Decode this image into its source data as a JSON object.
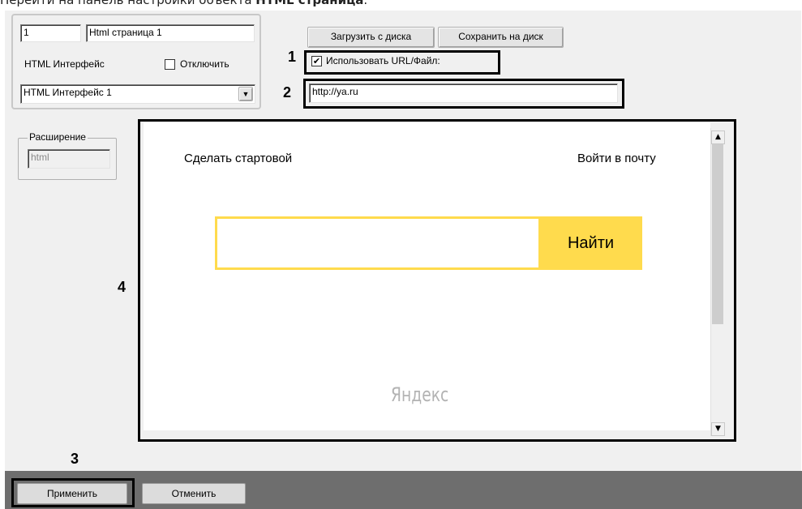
{
  "caption": {
    "text_prefix": "Перейти на панель настройки объекта ",
    "text_bold": "HTML страница",
    "text_suffix": "."
  },
  "object": {
    "id": "1",
    "name": "Html страница 1"
  },
  "interface": {
    "label": "HTML Интерфейс",
    "disable_label": "Отключить",
    "disable_checked": false,
    "selected": "HTML Интерфейс 1"
  },
  "toolbar": {
    "load_label": "Загрузить с диска",
    "save_label": "Сохранить на диск"
  },
  "use_url": {
    "label": "Использовать URL/Файл:",
    "checked": true,
    "check_glyph": "✔"
  },
  "url": {
    "value": "http://ya.ru"
  },
  "extension": {
    "group_label": "Расширение",
    "value": "html"
  },
  "browser": {
    "make_start": "Сделать стартовой",
    "login_mail": "Войти в почту",
    "search_value": "",
    "search_button": "Найти",
    "logo": "Яндекс"
  },
  "scrollbar": {
    "up_glyph": "▲",
    "down_glyph": "▼"
  },
  "dropdown": {
    "arrow_glyph": "▼"
  },
  "footer": {
    "apply_label": "Применить",
    "cancel_label": "Отменить"
  },
  "callouts": {
    "c1": "1",
    "c2": "2",
    "c3": "3",
    "c4": "4"
  },
  "colors": {
    "panel_bg": "#f0f0f0",
    "search_border": "#ffdb4d",
    "search_button_bg": "#ffdb4d",
    "logo_color": "#b3b3b3",
    "footer_bg": "#6e6e6e"
  }
}
